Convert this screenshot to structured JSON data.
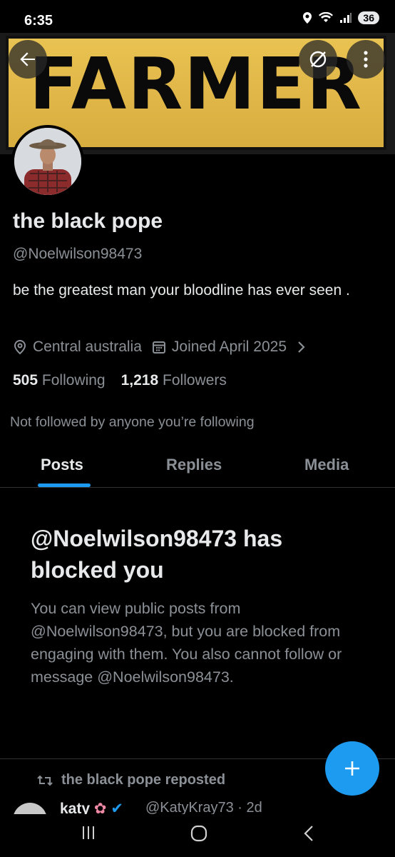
{
  "status_bar": {
    "time": "6:35",
    "battery": "36"
  },
  "banner": {
    "sign_text": "FARMER"
  },
  "profile": {
    "display_name": "the black pope",
    "handle": "@Noelwilson98473",
    "bio": "be the greatest man your bloodline has ever seen .",
    "location": "Central australia",
    "joined": "Joined April 2025",
    "following_count": "505",
    "following_label": "Following",
    "followers_count": "1,218",
    "followers_label": "Followers",
    "not_followed": "Not followed by anyone you’re following"
  },
  "tabs": [
    {
      "label": "Posts",
      "selected": true
    },
    {
      "label": "Replies",
      "selected": false
    },
    {
      "label": "Media",
      "selected": false
    }
  ],
  "blocked": {
    "title": "@Noelwilson98473 has blocked you",
    "body": "You can view public posts from @Noelwilson98473, but you are blocked from engaging with them. You also cannot follow or message @Noelwilson98473."
  },
  "repost": {
    "text": "the black pope reposted"
  },
  "tweet": {
    "name": "katy",
    "meta": "@KatyKray73 · 2d"
  },
  "colors": {
    "accent": "#1d9bf0",
    "muted": "#8b9096",
    "text": "#e7e9ea",
    "background": "#000000"
  },
  "icons": [
    "back-arrow-icon",
    "mute-icon",
    "more-vertical-icon",
    "location-icon",
    "calendar-icon",
    "chevron-right-icon",
    "repost-icon",
    "plus-icon"
  ]
}
